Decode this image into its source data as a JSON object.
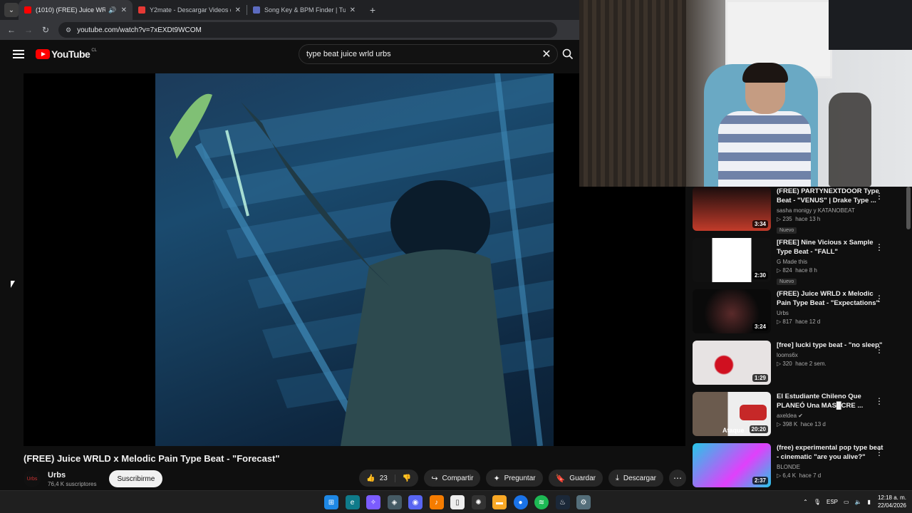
{
  "browser": {
    "tabs": [
      {
        "title": "(1010) (FREE) Juice WRLD x",
        "active": true,
        "favicon_color": "#ff0000"
      },
      {
        "title": "Y2mate - Descargar Videos de",
        "active": false,
        "favicon_color": "#e53935"
      },
      {
        "title": "Song Key & BPM Finder | Tunel",
        "active": false,
        "favicon_color": "#5c6bc0"
      }
    ],
    "url": "youtube.com/watch?v=7xEXDt9WCOM"
  },
  "youtube": {
    "logo_text": "YouTube",
    "country_code": "CL",
    "search_query": "type beat juice wrld urbs",
    "video_title": "(FREE) Juice WRLD x Melodic Pain Type Beat - \"Forecast\"",
    "channel": {
      "name": "Urbs",
      "subscribers": "76,4 K suscriptores",
      "subscribe_label": "Suscribirme",
      "avatar_text": "Urbs"
    },
    "actions": {
      "like_count": "23",
      "share": "Compartir",
      "ask": "Preguntar",
      "save": "Guardar",
      "download": "Descargar"
    },
    "recommendations": [
      {
        "title": "(FREE) PARTYNEXTDOOR Type Beat - \"VENUS\" | Drake Type ...",
        "channel": "sasha monigy y KATANOBEAT",
        "views": "235",
        "age": "hace 13 h",
        "duration": "3:34",
        "badge": "Nuevo",
        "thumb_colors": [
          "#1a0d0d",
          "#c23b2a"
        ]
      },
      {
        "title": "[FREE] Nine Vicious x Sample Type Beat - \"FALL\"",
        "channel": "G Made this",
        "views": "824",
        "age": "hace 8 h",
        "duration": "2:30",
        "badge": "Nuevo",
        "thumb_colors": [
          "#ffffff",
          "#222222"
        ]
      },
      {
        "title": "(FREE) Juice WRLD x Melodic Pain Type Beat - \"Expectations\"",
        "channel": "Urbs",
        "views": "817",
        "age": "hace 12 d",
        "duration": "3:24",
        "badge": "",
        "thumb_colors": [
          "#0a0a0a",
          "#5a2a2a"
        ]
      },
      {
        "title": "[free] lucki type beat - \"no sleep\"",
        "channel": "looms6x",
        "views": "320",
        "age": "hace 2 sem.",
        "duration": "1:29",
        "badge": "",
        "thumb_colors": [
          "#e7e3e3",
          "#d01020"
        ]
      },
      {
        "title": "El Estudiante Chileno Que PLANEÓ Una MAS█CRE ...",
        "channel": "axeldea",
        "views": "398 K",
        "age": "hace 13 d",
        "duration": "20:20",
        "badge": "",
        "thumb_colors": [
          "#6b5b4e",
          "#c62828"
        ]
      },
      {
        "title": "(free) experimental pop type beat - cinematic  \"are you alive?\"",
        "channel": "BLONDE",
        "views": "6,4 K",
        "age": "hace 7 d",
        "duration": "2:37",
        "badge": "",
        "thumb_colors": [
          "#25c7e8",
          "#e040fb"
        ]
      }
    ],
    "rec_thumb_overlay_text": "Ataque"
  },
  "taskbar": {
    "language": "ESP",
    "time": "12:18 a. m.",
    "date": "22/04/2026"
  }
}
